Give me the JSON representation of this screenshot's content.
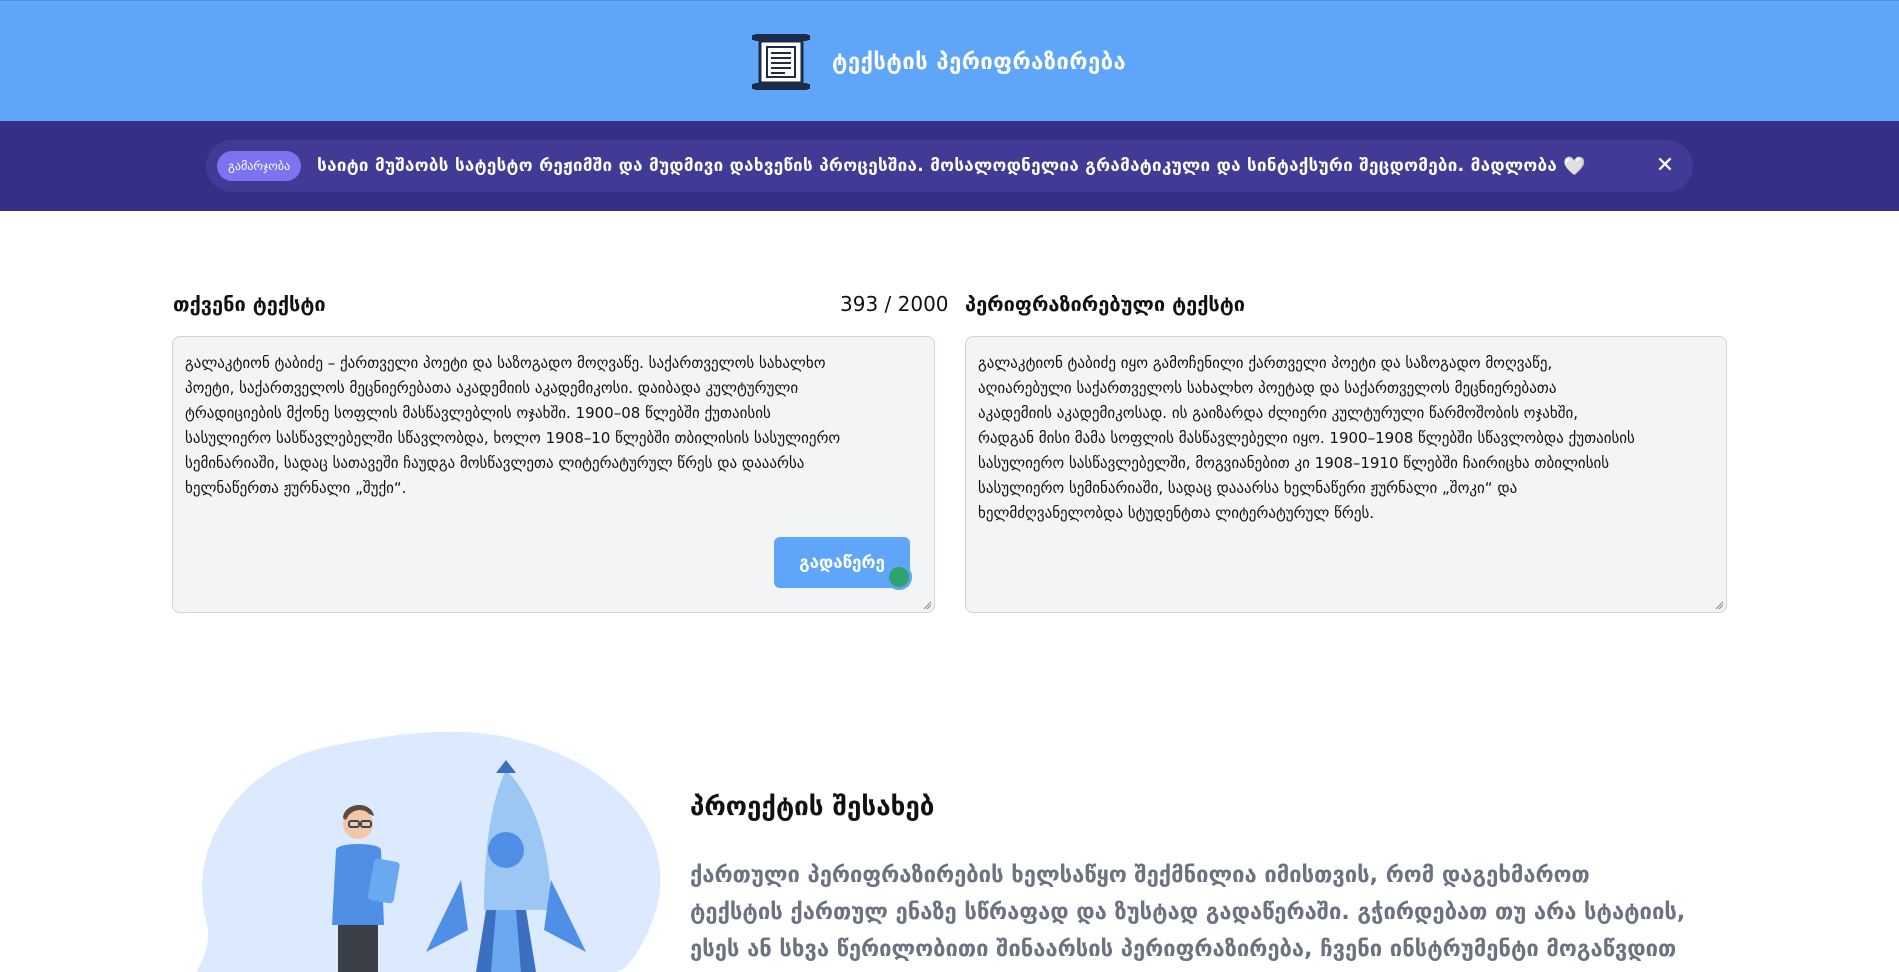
{
  "header": {
    "title": "ტექსტის პერიფრაზირება",
    "icon": "scroll-document-icon",
    "color": "#5fa5f9"
  },
  "banner": {
    "badge": "გამარჯობა",
    "message": "საიტი მუშაობს სატესტო რეჟიმში და მუდმივი დახვეწის პროცესშია. მოსალოდნელია გრამატიკული და სინტაქსური შეცდომები. მადლობა",
    "heart": "🤍",
    "close": "✕",
    "color": "#352f86"
  },
  "input": {
    "label": "თქვენი ტექსტი",
    "counter": "393 / 2000",
    "lines": [
      "გალაკტიონ ტაბიძე – ქართველი პოეტი და საზოგადო მოღვაწე. საქართველოს სახალხო",
      "პოეტი, საქართველოს მეცნიერებათა აკადემიის აკადემიკოსი. დაიბადა კულტურული",
      "ტრადიციების მქონე სოფლის მასწავლებლის ოჯახში. 1900–08 წლებში ქუთაისის",
      "სასულიერო სასწავლებელში სწავლობდა, ხოლო 1908–10 წლებში თბილისის სასულიერო",
      "სემინარიაში, სადაც სათავეში ჩაუდგა მოსწავლეთა ლიტერატურულ წრეს და დააარსა",
      "ხელნაწერთა ჟურნალი „შუქი“."
    ],
    "button": "გადაწერე"
  },
  "output": {
    "label": "პერიფრაზირებული ტექსტი",
    "lines": [
      "გალაკტიონ ტაბიძე იყო გამოჩენილი ქართველი პოეტი და საზოგადო მოღვაწე,",
      "აღიარებული საქართველოს სახალხო პოეტად და საქართველოს მეცნიერებათა",
      "აკადემიის აკადემიკოსად. ის გაიზარდა ძლიერი კულტურული წარმოშობის ოჯახში,",
      "რადგან მისი მამა სოფლის მასწავლებელი იყო. 1900–1908 წლებში სწავლობდა ქუთაისის",
      "სასულიერო სასწავლებელში, მოგვიანებით კი 1908–1910 წლებში ჩაირიცხა თბილისის",
      "სასულიერო სემინარიაში, სადაც დააარსა ხელნაწერი ჟურნალი „შოკი“ და",
      "ხელმძღვანელობდა სტუდენტთა ლიტერატურულ წრეს."
    ]
  },
  "about": {
    "title": "პროექტის შესახებ",
    "lines": [
      "ქართული პერიფრაზირების ხელსაწყო შექმნილია იმისთვის, რომ დაგეხმაროთ",
      "ტექსტის ქართულ ენაზე სწრაფად და ზუსტად გადაწერაში. გჭირდებათ თუ არა სტატიის,",
      "ესეს ან სხვა წერილობითი შინაარსის პერიფრაზირება, ჩვენი ინსტრუმენტი მოგაწვდით"
    ],
    "illustration": "rocket-and-person-illustration"
  }
}
